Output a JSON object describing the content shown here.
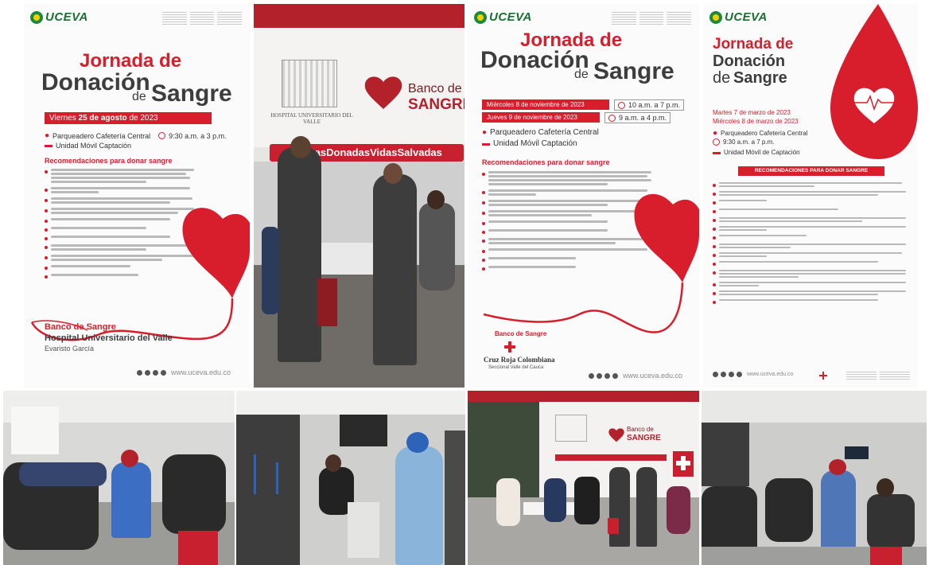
{
  "poster1": {
    "logo": "UCEVA",
    "title_1": "Jornada de",
    "title_2": "Donación",
    "title_de": "de",
    "title_3": "Sangre",
    "date_prefix": "Viernes",
    "date_bold": "25 de agosto",
    "date_suffix": "de 2023",
    "location": "Parqueadero Cafetería Central",
    "time": "9:30 a.m. a 3 p.m.",
    "unit": "Unidad Móvil Captación",
    "rec_title": "Recomendaciones para donar sangre",
    "bank_label": "Banco de Sangre",
    "bank_name": "Hospital Universitario del Valle",
    "bank_sub": "Evaristo García",
    "url": "www.uceva.edu.co"
  },
  "photo1": {
    "hospital_sign": "HOSPITAL UNIVERSITARIO DEL VALLE",
    "bank_sign_1": "Banco de",
    "bank_sign_2": "SANGRE",
    "hashtag": "#GotasDonadasVidasSalvadas"
  },
  "poster2": {
    "logo": "UCEVA",
    "title_1": "Jornada de",
    "title_2": "Donación",
    "title_de": "de",
    "title_3": "Sangre",
    "date1": "Miércoles 8 de noviembre de 2023",
    "time1": "10 a.m. a 7 p.m.",
    "date2": "Jueves 9 de noviembre de 2023",
    "time2": "9 a.m. a 4 p.m.",
    "location": "Parqueadero Cafetería Central",
    "unit": "Unidad Móvil Captación",
    "rec_title": "Recomendaciones para donar sangre",
    "bank_label": "Banco de Sangre",
    "cross_name": "Cruz Roja Colombiana",
    "cross_sub": "Seccional Valle del Cauca",
    "url": "www.uceva.edu.co"
  },
  "poster3": {
    "logo": "UCEVA",
    "title_1": "Jornada de",
    "title_2": "Donación",
    "title_de": "de",
    "title_3": "Sangre",
    "date1": "Martes 7 de marzo de 2023",
    "date2": "Miércoles 8 de marzo de 2023",
    "location": "Parqueadero Cafetería Central",
    "time": "9:30 a.m. a 7 p.m.",
    "unit": "Unidad Móvil de Captación",
    "rec_title": "RECOMENDACIONES PARA DONAR SANGRE",
    "url": "www.uceva.edu.co"
  },
  "photo6": {
    "bank_sign_1": "Banco de",
    "bank_sign_2": "SANGRE"
  },
  "colors": {
    "brand_red": "#d81e2c",
    "uceva_green": "#1c6f34",
    "text_dark": "#3d3d3d"
  }
}
